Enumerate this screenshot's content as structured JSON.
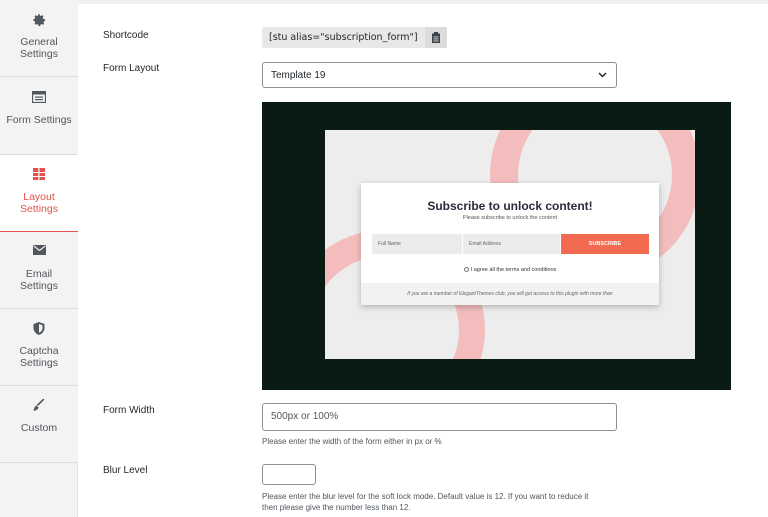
{
  "sidebar": {
    "items": [
      {
        "label": "General Settings",
        "icon": "gear-icon"
      },
      {
        "label": "Form Settings",
        "icon": "form-icon"
      },
      {
        "label": "Layout Settings",
        "icon": "layout-icon"
      },
      {
        "label": "Email Settings",
        "icon": "envelope-icon"
      },
      {
        "label": "Captcha Settings",
        "icon": "shield-icon"
      },
      {
        "label": "Custom",
        "icon": "brush-icon"
      }
    ],
    "active_index": 2,
    "accent_color": "#e2534e"
  },
  "fields": {
    "shortcode": {
      "label": "Shortcode",
      "value": "[stu alias=\"subscription_form\"]"
    },
    "form_layout": {
      "label": "Form Layout",
      "selected": "Template 19"
    },
    "form_width": {
      "label": "Form Width",
      "placeholder": "500px or 100%",
      "help": "Please enter the width of the form either in px or %"
    },
    "blur_level": {
      "label": "Blur Level",
      "value": "",
      "help_line1": "Please enter the blur level for the soft lock mode. Default value is 12. If you want to reduce it",
      "help_line2": "then please give the number less than 12."
    }
  },
  "preview": {
    "title": "Subscribe to unlock content!",
    "subtitle": "Please subscribe to unlock the content",
    "name_placeholder": "Full Name",
    "email_placeholder": "Email Address",
    "button": "SUBSCRIBE",
    "agree": "I agree all the terms and conditions",
    "footer": "If you are a member of ElegantThemes club, you will get access to this plugin with more than",
    "colors": {
      "frame": "#091b12",
      "button": "#f26b50",
      "ring": "#f4bdbd"
    }
  }
}
